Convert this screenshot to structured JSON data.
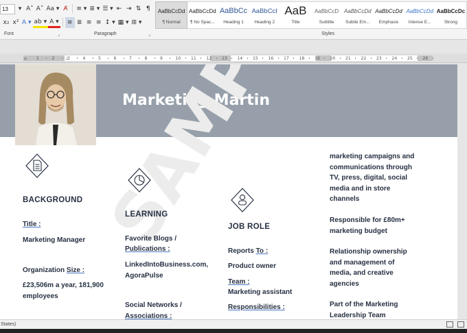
{
  "ribbon": {
    "font_size": "13",
    "row1_tools": [
      "A˄",
      "A˅",
      "Aa ▾",
      "A̸"
    ],
    "paragraph_tools_row1": [
      "≡ ▾",
      "≣ ▾",
      "☰ ▾",
      "⇤",
      "⇥",
      "⇅",
      "¶"
    ],
    "row2_tools": [
      "x₂",
      "x²",
      "A ▾",
      "ab ▾",
      "A ▾"
    ],
    "paragraph_tools_row2": [
      "≡",
      "≣",
      "≡",
      "≡",
      "↕ ▾",
      "▦ ▾",
      "⊞ ▾"
    ],
    "groups": {
      "font": "Font",
      "paragraph": "Paragraph",
      "styles": "Styles"
    },
    "styles": [
      {
        "preview": "AaBbCcDd",
        "name": "¶ Normal"
      },
      {
        "preview": "AaBbCcDd",
        "name": "¶ No Spac..."
      },
      {
        "preview": "AaBbCc",
        "name": "Heading 1"
      },
      {
        "preview": "AaBbCcI",
        "name": "Heading 2"
      },
      {
        "preview": "AaB",
        "name": "Title"
      },
      {
        "preview": "AaBbCcD",
        "name": "Subtitle"
      },
      {
        "preview": "AaBbCcDd",
        "name": "Subtle Em..."
      },
      {
        "preview": "AaBbCcDd",
        "name": "Emphasis"
      },
      {
        "preview": "AaBbCcDd",
        "name": "Intense E..."
      },
      {
        "preview": "AaBbCcDc",
        "name": "Strong"
      }
    ]
  },
  "ruler": {
    "numbers": [
      "1",
      "2",
      "3",
      "4",
      "5",
      "6",
      "7",
      "8",
      "9",
      "10",
      "11",
      "12",
      "13",
      "14",
      "15",
      "16",
      "17",
      "18",
      "19",
      "20",
      "21",
      "22",
      "23",
      "24",
      "25",
      "26"
    ]
  },
  "cv": {
    "name": "Marketing Martin",
    "watermark": "SAMPLE",
    "background": {
      "heading": "BACKGROUND",
      "title_label": "Title :",
      "title_value": "Marketing Manager",
      "org_label_1": "Organization ",
      "org_label_2": "Size :",
      "org_value_1": "£23,506m a year, 181,900",
      "org_value_2": "employees"
    },
    "learning": {
      "heading": "LEARNING",
      "blogs_label_1": "Favorite Blogs /",
      "blogs_label_2": "Publications :",
      "blogs_value_1": "LinkedIntoBusiness.com,",
      "blogs_value_2": "AgoraPulse",
      "social_label_1": "Social Networks /",
      "social_label_2": "Associations  :"
    },
    "job_role": {
      "heading": "JOB ROLE",
      "reports_label_1": "Reports ",
      "reports_label_2": "To :",
      "reports_value": "Product owner",
      "team_label": "Team :",
      "team_value": "Marketing assistant",
      "resp_label": "Responsibilities :"
    },
    "responsibilities": {
      "p1": [
        "marketing campaigns and",
        "communications through",
        "TV, press, digital, social",
        "media and in store",
        "channels"
      ],
      "p2": [
        "Responsible for £80m+",
        "marketing budget"
      ],
      "p3": [
        "Relationship ownership",
        "and management of",
        "media, and creative",
        "agencies"
      ],
      "p4": [
        "Part of the Marketing",
        "Leadership Team"
      ]
    }
  },
  "status": {
    "text": "States)"
  },
  "colors": {
    "banner": "#97a0aa",
    "text": "#263042",
    "accent_underline": "#4a78c0"
  }
}
